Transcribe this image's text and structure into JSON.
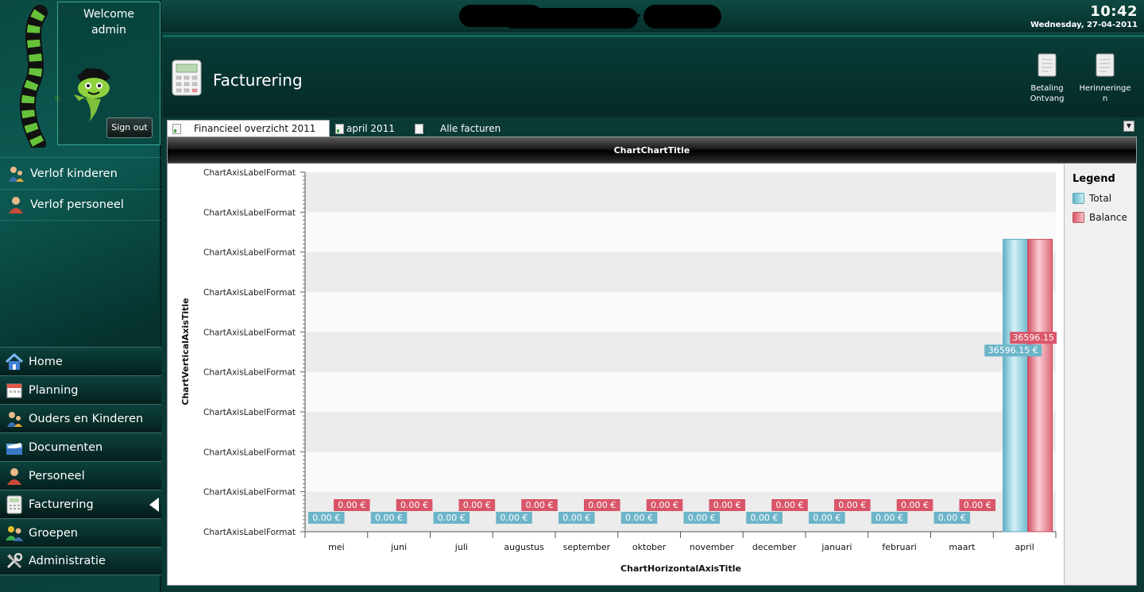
{
  "user": {
    "welcome": "Welcome",
    "name": "admin",
    "signout_label": "Sign out"
  },
  "clock": {
    "time": "10:42",
    "date": "Wednesday, 27-04-2011"
  },
  "quick_links": [
    {
      "label": "Verlof kinderen",
      "icon": "parent-child-icon"
    },
    {
      "label": "Verlof personeel",
      "icon": "person-icon"
    }
  ],
  "nav": [
    {
      "label": "Home",
      "icon": "house-icon"
    },
    {
      "label": "Planning",
      "icon": "calendar-icon"
    },
    {
      "label": "Ouders en Kinderen",
      "icon": "parent-child-icon"
    },
    {
      "label": "Documenten",
      "icon": "documents-icon"
    },
    {
      "label": "Personeel",
      "icon": "person-icon"
    },
    {
      "label": "Facturering",
      "icon": "calculator-icon",
      "active": true
    },
    {
      "label": "Groepen",
      "icon": "group-icon"
    },
    {
      "label": "Administratie",
      "icon": "tools-icon"
    }
  ],
  "page": {
    "title": "Facturering"
  },
  "header_buttons": [
    {
      "label_line1": "Betaling",
      "label_line2": "Ontvang"
    },
    {
      "label_line1": "Herinneringe",
      "label_line2": "n"
    }
  ],
  "tabs": [
    {
      "label": "Financieel overzicht 2011",
      "active": true
    },
    {
      "label": "april 2011",
      "active": false
    },
    {
      "label": "Alle facturen",
      "active": false
    }
  ],
  "colors": {
    "total": "#7ec4d6",
    "balance": "#e2707e",
    "total_label": "#6db5c9",
    "balance_label": "#d9566a"
  },
  "chart_data": {
    "type": "bar",
    "title": "ChartChartTitle",
    "xlabel": "ChartHorizontalAxisTitle",
    "ylabel": "ChartVerticalAxisTitle",
    "ytick_label": "ChartAxisLabelFormat",
    "ytick_count": 10,
    "categories": [
      "mei",
      "juni",
      "juli",
      "augustus",
      "september",
      "oktober",
      "november",
      "december",
      "januari",
      "februari",
      "maart",
      "april"
    ],
    "series": [
      {
        "name": "Total",
        "values": [
          0,
          0,
          0,
          0,
          0,
          0,
          0,
          0,
          0,
          0,
          0,
          36596.15
        ],
        "labels": [
          "0.00 €",
          "0.00 €",
          "0.00 €",
          "0.00 €",
          "0.00 €",
          "0.00 €",
          "0.00 €",
          "0.00 €",
          "0.00 €",
          "0.00 €",
          "0.00 €",
          "36596.15 €"
        ]
      },
      {
        "name": "Balance",
        "values": [
          0,
          0,
          0,
          0,
          0,
          0,
          0,
          0,
          0,
          0,
          0,
          36596.15
        ],
        "labels": [
          "0.00 €",
          "0.00 €",
          "0.00 €",
          "0.00 €",
          "0.00 €",
          "0.00 €",
          "0.00 €",
          "0.00 €",
          "0.00 €",
          "0.00 €",
          "0.00 €",
          "36596.15"
        ]
      }
    ],
    "ylim": [
      0,
      45000
    ],
    "grid": true,
    "legend_title": "Legend",
    "legend_position": "right"
  }
}
